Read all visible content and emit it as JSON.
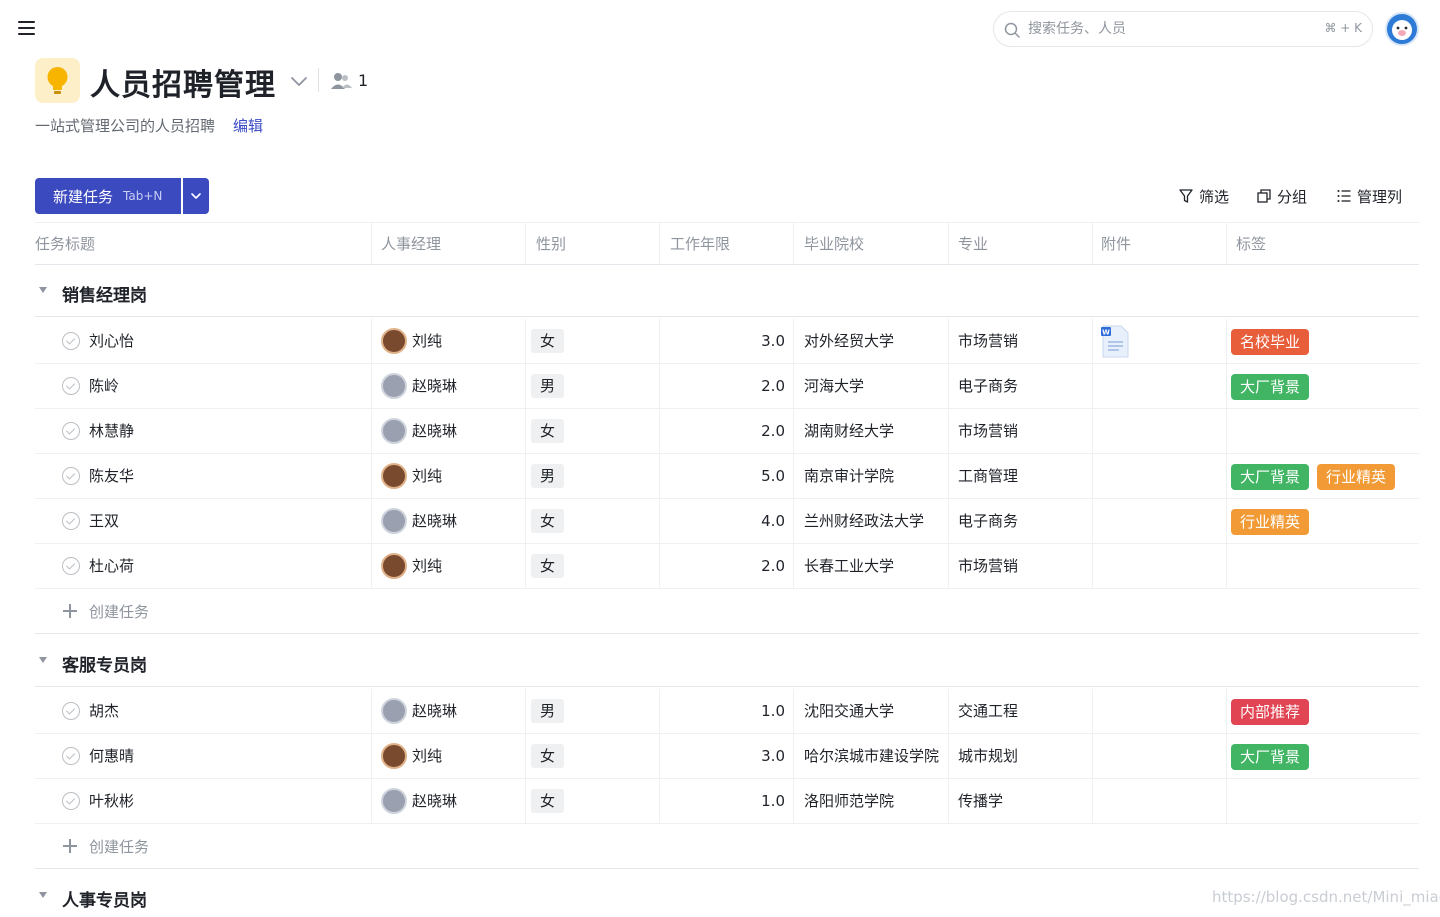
{
  "search": {
    "placeholder": "搜索任务、人员",
    "shortcut": "⌘ + K"
  },
  "project": {
    "title": "人员招聘管理",
    "member_count": "1",
    "description": "一站式管理公司的人员招聘",
    "edit_label": "编辑"
  },
  "toolbar": {
    "new_task_label": "新建任务",
    "new_task_hint": "Tab+N",
    "filter_label": "筛选",
    "group_label": "分组",
    "columns_label": "管理列"
  },
  "columns": [
    "任务标题",
    "人事经理",
    "性别",
    "工作年限",
    "毕业院校",
    "专业",
    "附件",
    "标签"
  ],
  "colors": {
    "primary": "#3c4ac0",
    "tag_名校毕业": "#e85d3a",
    "tag_大厂背景": "#41b564",
    "tag_行业精英": "#f19a36",
    "tag_内部推荐": "#e14452"
  },
  "groups": [
    {
      "name": "销售经理岗",
      "create_label": "创建任务",
      "rows": [
        {
          "title": "刘心怡",
          "manager": "刘纯",
          "gender": "女",
          "years": "3.0",
          "school": "对外经贸大学",
          "major": "市场营销",
          "attachment": "word-doc-icon",
          "tags": [
            "名校毕业"
          ]
        },
        {
          "title": "陈岭",
          "manager": "赵晓琳",
          "gender": "男",
          "years": "2.0",
          "school": "河海大学",
          "major": "电子商务",
          "attachment": "",
          "tags": [
            "大厂背景"
          ]
        },
        {
          "title": "林慧静",
          "manager": "赵晓琳",
          "gender": "女",
          "years": "2.0",
          "school": "湖南财经大学",
          "major": "市场营销",
          "attachment": "",
          "tags": []
        },
        {
          "title": "陈友华",
          "manager": "刘纯",
          "gender": "男",
          "years": "5.0",
          "school": "南京审计学院",
          "major": "工商管理",
          "attachment": "",
          "tags": [
            "大厂背景",
            "行业精英"
          ]
        },
        {
          "title": "王双",
          "manager": "赵晓琳",
          "gender": "女",
          "years": "4.0",
          "school": "兰州财经政法大学",
          "major": "电子商务",
          "attachment": "",
          "tags": [
            "行业精英"
          ]
        },
        {
          "title": "杜心荷",
          "manager": "刘纯",
          "gender": "女",
          "years": "2.0",
          "school": "长春工业大学",
          "major": "市场营销",
          "attachment": "",
          "tags": []
        }
      ]
    },
    {
      "name": "客服专员岗",
      "create_label": "创建任务",
      "rows": [
        {
          "title": "胡杰",
          "manager": "赵晓琳",
          "gender": "男",
          "years": "1.0",
          "school": "沈阳交通大学",
          "major": "交通工程",
          "attachment": "",
          "tags": [
            "内部推荐"
          ]
        },
        {
          "title": "何惠晴",
          "manager": "刘纯",
          "gender": "女",
          "years": "3.0",
          "school": "哈尔滨城市建设学院",
          "major": "城市规划",
          "attachment": "",
          "tags": [
            "大厂背景"
          ]
        },
        {
          "title": "叶秋彬",
          "manager": "赵晓琳",
          "gender": "女",
          "years": "1.0",
          "school": "洛阳师范学院",
          "major": "传播学",
          "attachment": "",
          "tags": []
        }
      ]
    },
    {
      "name": "人事专员岗",
      "rows": []
    }
  ],
  "watermark": "https://blog.csdn.net/Mini_miao"
}
